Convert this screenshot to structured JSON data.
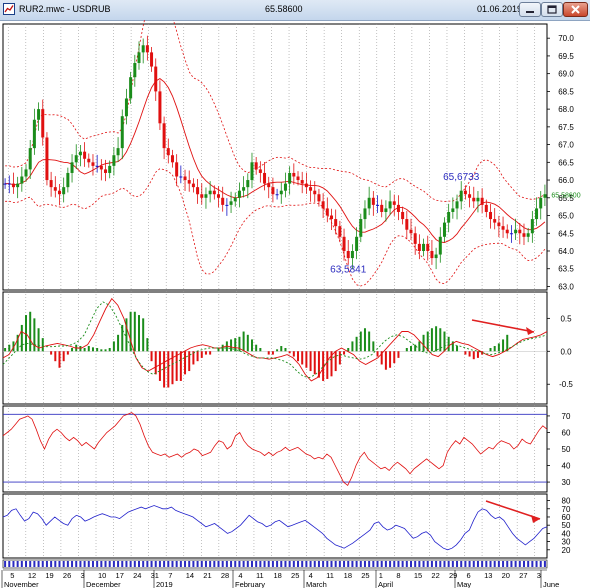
{
  "window": {
    "title": "RUR2.mwc - USDRUB",
    "price": "65.58600",
    "date": "01.06.2019",
    "controls": [
      "minimize-button",
      "maximize-button",
      "close-button"
    ],
    "icon": "chart-icon"
  },
  "colors": {
    "up": "#1a8c1a",
    "down": "#e01010",
    "neutral": "#1515c8",
    "ma": "#e01010",
    "band": "#e01010",
    "signal": "#1a8c1a",
    "rsi": "#e01010",
    "stoch": "#2222cc",
    "hline": "#3030c0"
  },
  "chart_data": [
    {
      "type": "candlestick",
      "panel": "price",
      "yticks": [
        "70.0",
        "69.5",
        "69.0",
        "68.5",
        "68.0",
        "67.5",
        "67.0",
        "66.5",
        "66.0",
        "65.5",
        "65.0",
        "64.5",
        "64.0",
        "63.5",
        "63.0"
      ],
      "ylim": [
        62.9,
        70.4
      ],
      "current_value_label": "65.58600",
      "annotations": [
        {
          "text": "65,6733",
          "x_index": 109,
          "y": 66.0
        },
        {
          "text": "63,5841",
          "x_index": 82,
          "y": 63.4
        }
      ],
      "close": [
        65.9,
        65.9,
        65.8,
        65.9,
        66.1,
        66.3,
        66.9,
        67.7,
        68.0,
        67.2,
        66.0,
        65.8,
        65.7,
        65.6,
        65.8,
        66.2,
        66.5,
        66.7,
        66.8,
        66.6,
        66.5,
        66.4,
        66.4,
        66.3,
        66.2,
        66.4,
        66.7,
        66.9,
        67.8,
        68.3,
        68.9,
        69.3,
        69.6,
        69.8,
        69.6,
        69.2,
        68.5,
        67.6,
        66.9,
        66.7,
        66.5,
        66.1,
        66.1,
        66.0,
        65.9,
        65.8,
        65.6,
        65.5,
        65.6,
        65.7,
        65.6,
        65.5,
        65.3,
        65.3,
        65.4,
        65.5,
        65.7,
        65.8,
        66.0,
        66.5,
        66.3,
        66.2,
        65.9,
        65.8,
        65.6,
        65.6,
        65.7,
        65.9,
        66.2,
        66.1,
        66.0,
        65.9,
        65.8,
        65.7,
        65.6,
        65.4,
        65.2,
        65.0,
        64.9,
        64.7,
        64.4,
        64.0,
        63.8,
        64.0,
        64.4,
        64.9,
        65.2,
        65.5,
        65.3,
        65.3,
        65.1,
        65.2,
        65.4,
        65.3,
        65.1,
        64.9,
        64.6,
        64.5,
        64.2,
        64.0,
        64.2,
        64.0,
        63.8,
        63.9,
        64.4,
        64.8,
        65.1,
        65.2,
        65.4,
        65.7,
        65.6,
        65.5,
        65.4,
        65.5,
        65.3,
        65.1,
        64.9,
        64.8,
        64.7,
        64.6,
        64.5,
        64.5,
        64.6,
        64.5,
        64.4,
        64.5,
        64.9,
        65.2,
        65.5,
        65.6
      ]
    },
    {
      "type": "bar",
      "panel": "macd",
      "yticks": [
        "0.5",
        "0.0",
        "-0.5"
      ],
      "ylim": [
        -0.8,
        0.9
      ],
      "series": [
        {
          "values": [
            0.05,
            0.1,
            0.15,
            0.25,
            0.4,
            0.55,
            0.6,
            0.5,
            0.35,
            0.2,
            0.0,
            -0.05,
            -0.15,
            -0.25,
            -0.15,
            -0.05,
            0.05,
            0.1,
            0.08,
            0.05,
            0.08,
            0.06,
            0.05,
            0.03,
            0.03,
            0.05,
            0.15,
            0.25,
            0.4,
            0.5,
            0.6,
            0.6,
            0.55,
            0.5,
            0.2,
            -0.15,
            -0.35,
            -0.45,
            -0.55,
            -0.55,
            -0.5,
            -0.45,
            -0.45,
            -0.35,
            -0.3,
            -0.2,
            -0.15,
            -0.1,
            -0.05,
            -0.05,
            0.0,
            0.05,
            0.1,
            0.15,
            0.18,
            0.2,
            0.22,
            0.3,
            0.25,
            0.18,
            0.1,
            0.05,
            0.0,
            -0.05,
            -0.05,
            0.03,
            0.08,
            0.05,
            -0.03,
            -0.08,
            -0.15,
            -0.2,
            -0.25,
            -0.3,
            -0.35,
            -0.4,
            -0.45,
            -0.42,
            -0.38,
            -0.3,
            -0.2,
            -0.05,
            0.05,
            0.15,
            0.22,
            0.3,
            0.35,
            0.3,
            0.15,
            -0.08,
            -0.2,
            -0.28,
            -0.25,
            -0.18,
            -0.1,
            0.0,
            0.05,
            0.08,
            0.1,
            0.15,
            0.25,
            0.3,
            0.35,
            0.38,
            0.35,
            0.3,
            0.22,
            0.15,
            0.08,
            0.0,
            -0.05,
            -0.08,
            -0.12,
            -0.1,
            -0.05,
            0.0,
            0.05,
            0.08,
            0.12,
            0.18,
            0.25
          ]
        },
        {
          "values": [
            -0.1,
            -0.05,
            0.1,
            0.3,
            0.25,
            0.1,
            0.05,
            0.08,
            0.1,
            0.12,
            0.1,
            0.08,
            0.05,
            0.05,
            0.1,
            0.25,
            0.45,
            0.65,
            0.8,
            0.7,
            0.5,
            0.2,
            -0.1,
            -0.25,
            -0.3,
            -0.25,
            -0.2,
            -0.15,
            -0.1,
            -0.05,
            0.0,
            0.05,
            0.08,
            0.1,
            0.08,
            0.05,
            0.05,
            0.08,
            0.06,
            0.05,
            0.0,
            -0.05,
            -0.1,
            -0.1,
            -0.12,
            -0.1,
            -0.08,
            -0.05,
            -0.1,
            -0.2,
            -0.35,
            -0.45,
            -0.4,
            -0.25,
            -0.1,
            0.0,
            0.05,
            0.0,
            -0.05,
            -0.15,
            -0.2,
            -0.15,
            -0.1,
            0.0,
            0.1,
            0.2,
            0.3,
            0.3,
            0.25,
            0.15,
            0.05,
            -0.05,
            -0.08,
            0.0,
            0.1,
            0.15,
            0.12,
            0.1,
            0.05,
            0.0,
            -0.05,
            -0.08,
            -0.05,
            0.0,
            0.05,
            0.12,
            0.18,
            0.2,
            0.22,
            0.25,
            0.3
          ]
        },
        {
          "values": [
            -0.2,
            -0.1,
            0.0,
            0.1,
            0.12,
            0.1,
            0.08,
            0.07,
            0.07,
            0.08,
            0.08,
            0.1,
            0.15,
            0.25,
            0.45,
            0.65,
            0.75,
            0.7,
            0.55,
            0.35,
            0.15,
            -0.05,
            -0.2,
            -0.3,
            -0.35,
            -0.3,
            -0.25,
            -0.2,
            -0.15,
            -0.1,
            -0.05,
            0.0,
            0.03,
            0.05,
            0.05,
            0.05,
            0.05,
            0.03,
            0.0,
            -0.05,
            -0.08,
            -0.1,
            -0.1,
            -0.1,
            -0.12,
            -0.15,
            -0.2,
            -0.3,
            -0.38,
            -0.4,
            -0.35,
            -0.25,
            -0.15,
            -0.08,
            -0.05,
            -0.08,
            -0.1,
            -0.12,
            -0.1,
            -0.05,
            0.05,
            0.15,
            0.22,
            0.25,
            0.22,
            0.15,
            0.08,
            0.0,
            -0.03,
            0.0,
            0.05,
            0.1,
            0.1,
            0.08,
            0.05,
            0.02,
            0.0,
            -0.03,
            -0.05,
            -0.03,
            0.0,
            0.05,
            0.1,
            0.15,
            0.18,
            0.2,
            0.22,
            0.25
          ]
        }
      ]
    },
    {
      "type": "line",
      "panel": "rsi",
      "yticks": [
        "70",
        "60",
        "50",
        "40",
        "30"
      ],
      "ylim": [
        24,
        76
      ],
      "hlines": [
        71,
        30
      ],
      "values": [
        58,
        60,
        62,
        65,
        68,
        69,
        70,
        68,
        62,
        55,
        50,
        56,
        60,
        62,
        60,
        57,
        55,
        57,
        55,
        52,
        54,
        52,
        50,
        54,
        57,
        60,
        62,
        64,
        67,
        70,
        71,
        72,
        70,
        65,
        58,
        52,
        48,
        47,
        46,
        47,
        45,
        46,
        47,
        45,
        47,
        48,
        50,
        49,
        46,
        47,
        48,
        52,
        55,
        54,
        50,
        52,
        58,
        60,
        55,
        52,
        50,
        49,
        48,
        46,
        48,
        46,
        48,
        49,
        51,
        49,
        50,
        51,
        49,
        47,
        46,
        44,
        45,
        44,
        47,
        45,
        40,
        35,
        30,
        28,
        33,
        40,
        45,
        48,
        44,
        42,
        40,
        38,
        39,
        37,
        40,
        42,
        40,
        38,
        35,
        38,
        40,
        42,
        44,
        42,
        40,
        38,
        40,
        48,
        52,
        55,
        53,
        57,
        55,
        53,
        50,
        47,
        49,
        51,
        50,
        53,
        55,
        54,
        53,
        50,
        52,
        56,
        54,
        53,
        57,
        61,
        64,
        62
      ]
    },
    {
      "type": "line",
      "panel": "stochastic",
      "yticks": [
        "80",
        "70",
        "60",
        "50",
        "40",
        "30",
        "20"
      ],
      "ylim": [
        10,
        88
      ],
      "values": [
        60,
        62,
        68,
        70,
        62,
        55,
        58,
        66,
        64,
        58,
        50,
        55,
        60,
        56,
        52,
        50,
        58,
        62,
        60,
        55,
        57,
        60,
        62,
        64,
        62,
        60,
        60,
        58,
        62,
        66,
        68,
        70,
        72,
        70,
        72,
        74,
        72,
        70,
        70,
        72,
        68,
        66,
        64,
        62,
        60,
        56,
        52,
        48,
        50,
        52,
        48,
        44,
        40,
        42,
        46,
        50,
        56,
        62,
        58,
        54,
        52,
        48,
        50,
        54,
        56,
        52,
        48,
        50,
        52,
        54,
        56,
        52,
        48,
        44,
        40,
        34,
        30,
        26,
        24,
        22,
        25,
        28,
        32,
        36,
        40,
        44,
        52,
        54,
        48,
        44,
        46,
        50,
        48,
        46,
        40,
        34,
        36,
        40,
        42,
        38,
        30,
        26,
        22,
        20,
        22,
        26,
        32,
        40,
        44,
        56,
        66,
        70,
        68,
        62,
        58,
        60,
        56,
        48,
        40,
        34,
        30,
        26,
        30,
        34,
        40,
        46,
        48
      ]
    }
  ],
  "x_axis": {
    "day_labels": [
      "5",
      "12",
      "19",
      "26",
      "3",
      "10",
      "17",
      "24",
      "31",
      "7",
      "14",
      "21",
      "28",
      "4",
      "11",
      "18",
      "25",
      "4",
      "11",
      "18",
      "25",
      "1",
      "8",
      "15",
      "22",
      "29",
      "6",
      "13",
      "20",
      "27",
      "3"
    ],
    "month_labels": [
      "November",
      "December",
      "2019",
      "February",
      "March",
      "April",
      "May",
      "June"
    ]
  }
}
